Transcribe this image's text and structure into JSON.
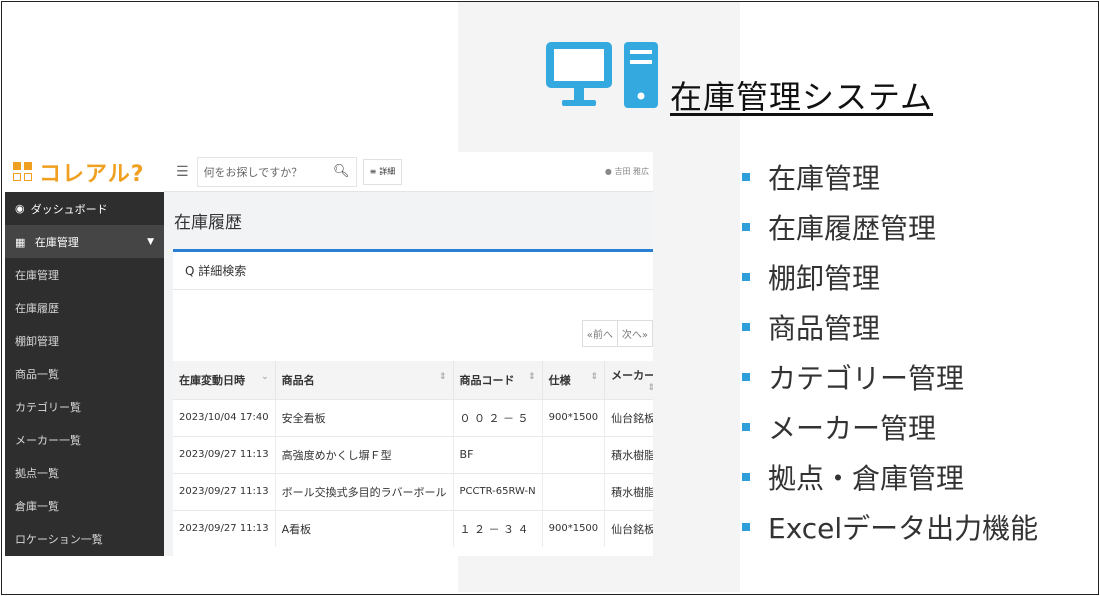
{
  "header": {
    "title": "在庫管理システム",
    "icon": "desktop-computer-icon",
    "accent_color": "#33a9e0"
  },
  "app": {
    "logo": {
      "text": "コレアル?",
      "icon": "logo-grid-icon"
    },
    "topbar": {
      "search_placeholder": "何をお探しですか？",
      "search_icon": "search-icon",
      "detail_label": "詳細",
      "user_name": "吉田 雅広"
    },
    "sidebar": {
      "dashboard": "ダッシュボード",
      "group": "在庫管理",
      "items": [
        {
          "label": "在庫管理"
        },
        {
          "label": "在庫履歴"
        },
        {
          "label": "棚卸管理"
        },
        {
          "label": "商品一覧"
        },
        {
          "label": "カテゴリー覧"
        },
        {
          "label": "メーカー一覧"
        },
        {
          "label": "拠点一覧"
        },
        {
          "label": "倉庫一覧"
        },
        {
          "label": "ロケーション一覧"
        }
      ]
    },
    "page_title": "在庫履歴",
    "advanced_search": "Q 詳細検索",
    "pager": {
      "prev": "«前へ",
      "next": "次へ»"
    },
    "table": {
      "columns": [
        "在庫変動日時",
        "商品名",
        "商品コード",
        "仕様",
        "メーカー"
      ],
      "rows": [
        [
          "2023/10/04 17:40",
          "安全看板",
          "０ ０ ２ － ５",
          "900*1500",
          "仙台銘板"
        ],
        [
          "2023/09/27 11:13",
          "高強度めかくし塀Ｆ型",
          "BF",
          "",
          "積水樹脂"
        ],
        [
          "2023/09/27 11:13",
          "ボール交換式多目的ラバーボール",
          "PCCTR-65RW-N",
          "",
          "積水樹脂"
        ],
        [
          "2023/09/27 11:13",
          "A看板",
          "１ ２ － ３ ４",
          "900*1500",
          "仙台銘板"
        ]
      ]
    }
  },
  "features": {
    "bullet_color": "#2e9fd8",
    "items": [
      "在庫管理",
      "在庫履歴管理",
      "棚卸管理",
      "商品管理",
      "カテゴリー管理",
      "メーカー管理",
      "拠点・倉庫管理",
      "Excelデータ出力機能"
    ]
  }
}
